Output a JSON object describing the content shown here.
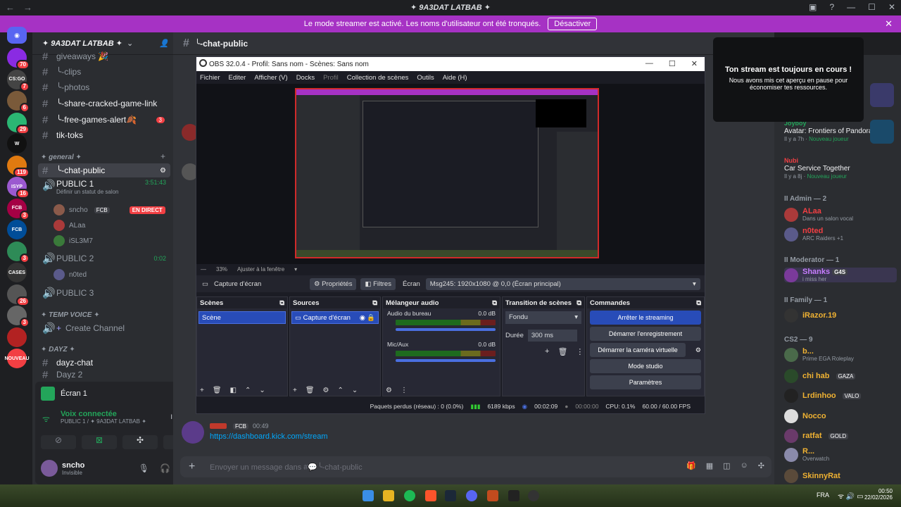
{
  "window": {
    "title": "✦ 9A3DAT LATBAB ✦",
    "back": "←",
    "forward": "→"
  },
  "banner": {
    "text": "Le mode streamer est activé. Les noms d'utilisateur ont été tronqués.",
    "button": "Désactiver"
  },
  "guilds": [
    {
      "label": "",
      "badge": "70",
      "color": "#8a2be2"
    },
    {
      "label": "CS:GO",
      "badge": "7",
      "color": "#444"
    },
    {
      "label": "",
      "badge": "6",
      "color": "#7a5a3a"
    },
    {
      "label": "",
      "badge": "29",
      "color": "#2bb673"
    },
    {
      "label": "W",
      "badge": "",
      "color": "#111"
    },
    {
      "label": "",
      "badge": "119",
      "color": "#e07a10"
    },
    {
      "label": "ISYP",
      "badge": "16",
      "color": "#9b59d0"
    },
    {
      "label": "FCB",
      "badge": "3",
      "color": "#a50044"
    },
    {
      "label": "FCB",
      "badge": "",
      "color": "#004d98"
    },
    {
      "label": "",
      "badge": "3",
      "color": "#2e8b57"
    },
    {
      "label": "CASES",
      "badge": "",
      "color": "#333"
    },
    {
      "label": "",
      "badge": "26",
      "color": "#555"
    },
    {
      "label": "",
      "badge": "3",
      "color": "#666"
    },
    {
      "label": "",
      "badge": "",
      "color": "#b22222"
    },
    {
      "label": "NOUVEAU",
      "badge": "",
      "color": "#f23f43"
    }
  ],
  "server": {
    "name": "✦ 9A3DAT LATBAB ✦"
  },
  "channels": {
    "c1": "giveaways 🎉",
    "c2": "╰-clips",
    "c3": "╰-photos",
    "c4": "╰-share-cracked-game-link",
    "c5": "╰-free-games-alert🍂",
    "c5_badge": "3",
    "c6": "tik-toks",
    "cat_general": "✦ general ✦",
    "c7": "╰-chat-public",
    "voice1": "PUBLIC 1",
    "voice1_time": "3:51:43",
    "voice1_status": "Définir un statut de salon",
    "u1": "sncho",
    "u1_tag": "FCB",
    "u1_live": "EN DIRECT",
    "u2": "ALaa",
    "u3": "iSL3M7",
    "voice2": "PUBLIC 2",
    "voice2_time": "0:02",
    "u4": "n0ted",
    "voice3": "PUBLIC 3",
    "cat_temp": "✦ TEMP VOICE ✦",
    "create": "Create Channel",
    "cat_dayz": "✦ DAYZ ✦",
    "c8": "dayz-chat",
    "c9": "Dayz 2"
  },
  "panel": {
    "screen": "Écran 1",
    "voice": "Voix connectée",
    "voice_sub": "PUBLIC 1 / ✦ 9A3DAT LATBAB ✦",
    "user": "sncho",
    "user_status": "Invisible"
  },
  "chat": {
    "channel": "╰-chat-public",
    "msg_tag": "FCB",
    "msg_time": "00:49",
    "msg_link": "https://dashboard.kick.com/stream",
    "input_placeholder": "Envoyer un message dans #💬╰-chat-public"
  },
  "tooltip": {
    "title": "Ton stream est toujours en cours !",
    "body": "Nous avons mis cet aperçu en pause pour économiser tes ressources."
  },
  "obs": {
    "title": "OBS 32.0.4 - Profil: Sans nom - Scènes: Sans nom",
    "menu": [
      "Fichier",
      "Editer",
      "Afficher (V)",
      "Docks",
      "Profil",
      "Collection de scènes",
      "Outils",
      "Aide (H)"
    ],
    "zoom": "33%",
    "zoom_label": "Ajuster à la fenêtre",
    "source_name": "Capture d'écran",
    "props": "Propriétés",
    "filters": "Filtres",
    "screen_label": "Écran",
    "screen_value": "Msg245: 1920x1080 @ 0,0 (Écran principal)",
    "scenes_h": "Scènes",
    "scene1": "Scène",
    "sources_h": "Sources",
    "source1": "Capture d'écran",
    "mixer_h": "Mélangeur audio",
    "mix1": "Audio du bureau",
    "mix1_db": "0.0 dB",
    "mix2": "Mic/Aux",
    "mix2_db": "0.0 dB",
    "trans_h": "Transition de scènes",
    "trans": "Fondu",
    "dur_label": "Durée",
    "dur": "300 ms",
    "cmd_h": "Commandes",
    "b1": "Arrêter le streaming",
    "b2": "Démarrer l'enregistrement",
    "b3": "Démarrer la caméra virtuelle",
    "b4": "Mode studio",
    "b5": "Paramètres",
    "st_drop": "Paquets perdus (réseau) : 0 (0.0%)",
    "st_kbps": "6189 kbps",
    "st_live": "00:02:09",
    "st_rec": "00:00:00",
    "st_cpu": "CPU: 0.1%",
    "st_fps": "60.00 / 60.00 FPS"
  },
  "members": {
    "a1_name": "Joyboy",
    "a1_game": "Avatar: Frontiers of Pandora",
    "a1_time": "Il y a 7h",
    "a1_new": "Nouveau joueur",
    "a2_name": "Nubi",
    "a2_game": "Car Service Together",
    "a2_time": "Il y a 8j",
    "a2_new": "Nouveau joueur",
    "g_admin": "II Admin — 2",
    "m1": "ALaa",
    "m1_sub": "Dans un salon vocal",
    "m2": "n0ted",
    "m2_sub": "ARC Raiders +1",
    "g_mod": "II Moderator — 1",
    "m3": "Shanks",
    "m3_tag": "G4S",
    "m3_sub": "i miss her",
    "g_fam": "II Family — 1",
    "m4": "iRazor.19",
    "g_cs2": "CS2 — 9",
    "m5": "b...",
    "m5_sub": "Prime EGA Roleplay",
    "m6": "chi hab",
    "m6_tag": "GAZA",
    "m7": "Lrdinhoo",
    "m7_tag": "VALO",
    "m8": "Nocco",
    "m9": "ratfat",
    "m9_tag": "GOLD",
    "m10": "R...",
    "m10_sub": "Overwatch",
    "m11": "SkinnyRat"
  },
  "taskbar": {
    "lang": "FRA",
    "time": "00:50",
    "date": "22/02/2026"
  }
}
